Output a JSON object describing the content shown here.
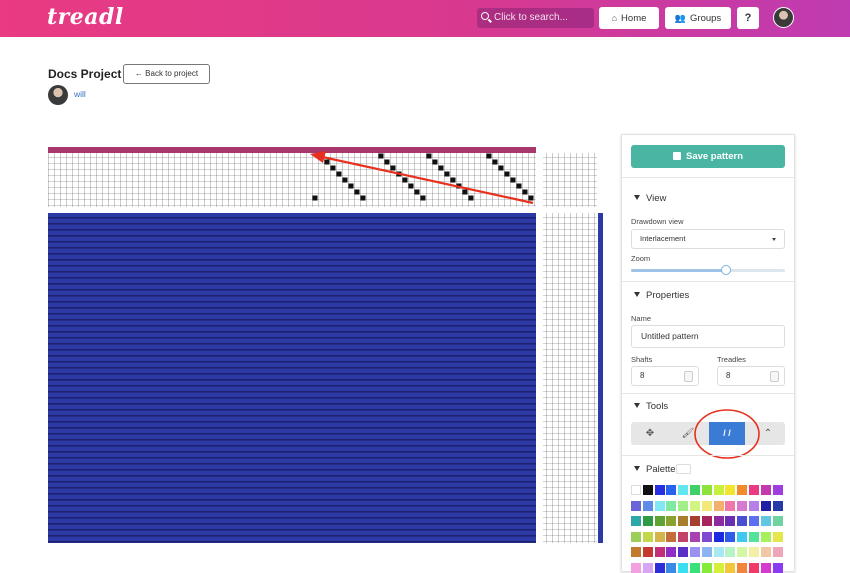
{
  "app": {
    "logo_text": "treadl"
  },
  "nav": {
    "search_placeholder": "Click to search...",
    "home_label": "Home",
    "groups_label": "Groups",
    "help_label": "?"
  },
  "project": {
    "title": "Docs Project",
    "back_label": "Back to project",
    "user": "will"
  },
  "panel": {
    "save_label": "Save pattern",
    "view": {
      "heading": "View",
      "drawdown_label": "Drawdown view",
      "drawdown_value": "Interlacement",
      "zoom_label": "Zoom",
      "zoom_fraction": 0.62
    },
    "properties": {
      "heading": "Properties",
      "name_label": "Name",
      "name_value": "Untitled pattern",
      "shafts_label": "Shafts",
      "shafts_value": "8",
      "treadles_label": "Treadles",
      "treadles_value": "8"
    },
    "tools": {
      "heading": "Tools",
      "items": [
        {
          "name": "move",
          "glyph": "✥"
        },
        {
          "name": "brush",
          "glyph": "🖌"
        },
        {
          "name": "straight-draw",
          "glyph": "/ /"
        },
        {
          "name": "collapse",
          "glyph": "⌃"
        }
      ],
      "active_index": 2
    },
    "palette": {
      "heading": "Palette",
      "colors": [
        [
          "#ffffff",
          "#111111",
          "#2730e0",
          "#2a62f0",
          "#62e6f0",
          "#3fd06a",
          "#8ee33b",
          "#c7f03d",
          "#f2e52c",
          "#f08a2b",
          "#e93a82",
          "#c13ab0",
          "#9f3ee0"
        ],
        [
          "#6a65d6",
          "#5d8be6",
          "#80e8f2",
          "#7fe9a2",
          "#a3ef87",
          "#d2f481",
          "#f3e978",
          "#f2b06e",
          "#ef78a8",
          "#d67ad0",
          "#b77fe8",
          "#1f1fa8",
          "#233aa8"
        ],
        [
          "#2ea7a8",
          "#2e9a45",
          "#5ea334",
          "#8ba32e",
          "#a87d2e",
          "#a6402e",
          "#a8245f",
          "#8e2aa0",
          "#6a2fb0",
          "#4c4ed1",
          "#5b6ff0",
          "#5fc7e0",
          "#6fd2a0"
        ],
        [
          "#9ccf5a",
          "#c2d74a",
          "#d3b54a",
          "#c46d3a",
          "#c2426a",
          "#a842b0",
          "#7d4ad1",
          "#1d2be0",
          "#2c5ce8",
          "#3fc8f0",
          "#54e39a",
          "#a6f05a",
          "#e6e74a"
        ],
        [
          "#c27a2e",
          "#c43a2e",
          "#c22e78",
          "#8f2ec2",
          "#5b2ec7",
          "#9a92f0",
          "#8ab4f2",
          "#a6e9f4",
          "#b8f4c8",
          "#d3f7a4",
          "#f2f0a4",
          "#f2c8a4",
          "#f0a4b8"
        ],
        [
          "#f2a0e0",
          "#d8a4f4",
          "#2e2ed8",
          "#3a8ae8",
          "#38dff0",
          "#3ae07a",
          "#86ea3a",
          "#d6f03a",
          "#f2c83a",
          "#f2853a",
          "#f03a6a",
          "#d43ad0",
          "#8a3af0"
        ]
      ]
    }
  }
}
